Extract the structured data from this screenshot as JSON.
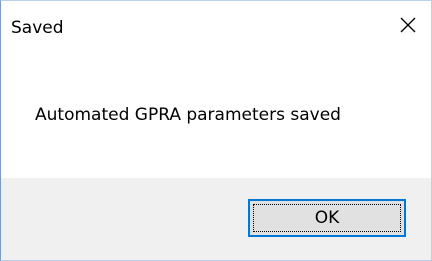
{
  "window": {
    "title": "Saved",
    "close_icon": "close-icon"
  },
  "dialog": {
    "message": "Automated GPRA parameters saved"
  },
  "buttons": {
    "ok_label": "OK"
  }
}
